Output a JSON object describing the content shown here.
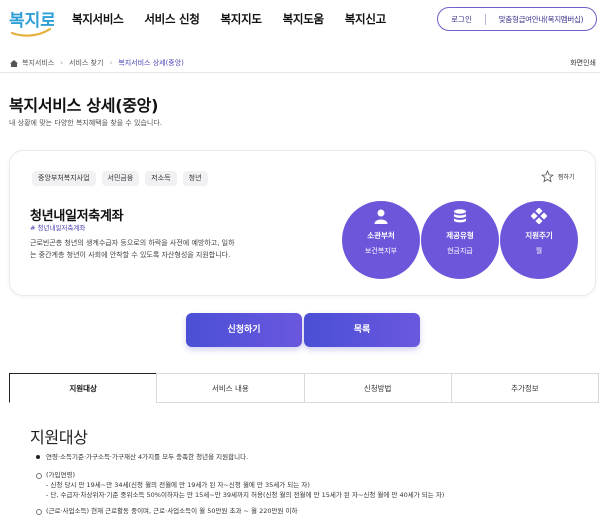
{
  "header": {
    "logo_text": "복지로",
    "nav": [
      "복지서비스",
      "서비스 신청",
      "복지지도",
      "복지도움",
      "복지신고"
    ],
    "login_label": "로그인",
    "custom_info_label": "맞춤형급여안내(복지멤버십)"
  },
  "breadcrumb": {
    "items": [
      "복지서비스",
      "서비스 찾기",
      "복지서비스 상세(중앙)"
    ],
    "print_label": "화면인쇄"
  },
  "page": {
    "title": "복지서비스 상세(중앙)",
    "subtitle": "내 상황에 맞는 다양한 복지혜택을 찾을 수 있습니다."
  },
  "service": {
    "tags": [
      "중앙부처복지사업",
      "서민금융",
      "저소득",
      "청년"
    ],
    "bookmark_label": "찜하기",
    "name": "청년내일저축계좌",
    "hashtag": "# 청년내일저축계좌",
    "description": "근로빈곤층 청년의 생계수급자 등으로의 하락을 사전에 예방하고, 일하는 중간계층 청년이 사회에 안착할 수 있도록 자산형성을 지원합니다.",
    "info": [
      {
        "icon": "person-icon",
        "label": "소관부처",
        "value": "보건복지부"
      },
      {
        "icon": "coins-icon",
        "label": "제공유형",
        "value": "현금지급"
      },
      {
        "icon": "cycle-icon",
        "label": "지원주기",
        "value": "월"
      }
    ],
    "accent_color": "#6d56d9"
  },
  "actions": {
    "apply_label": "신청하기",
    "list_label": "목록"
  },
  "tabs": [
    "지원대상",
    "서비스 내용",
    "신청방법",
    "추가정보"
  ],
  "section": {
    "title": "지원대상",
    "bullet": "연령·소득기준·가구소득·가구재산 4가지를 모두 충족한 청년을 지원합니다.",
    "age_header": "(가입연령)",
    "age_line1": "- 신청 당시 만 19세~만 34세(신청 월의 전월에 만 19세가 된 자~신청 월에 만 35세가 되는 자)",
    "age_line2": "- 단, 수급자·차상위자·기준 중위소득 50%이하자는 만 15세~만 39세까지 허용(신청 월의 전월에 만 15세가 된 자~신청 월에 만 40세가 되는 자)",
    "income_line": "(근로·사업소득) 현재 근로활동 중이며, 근로·사업소득이 월 50만원 초과 ~ 월 220만원 이하"
  }
}
